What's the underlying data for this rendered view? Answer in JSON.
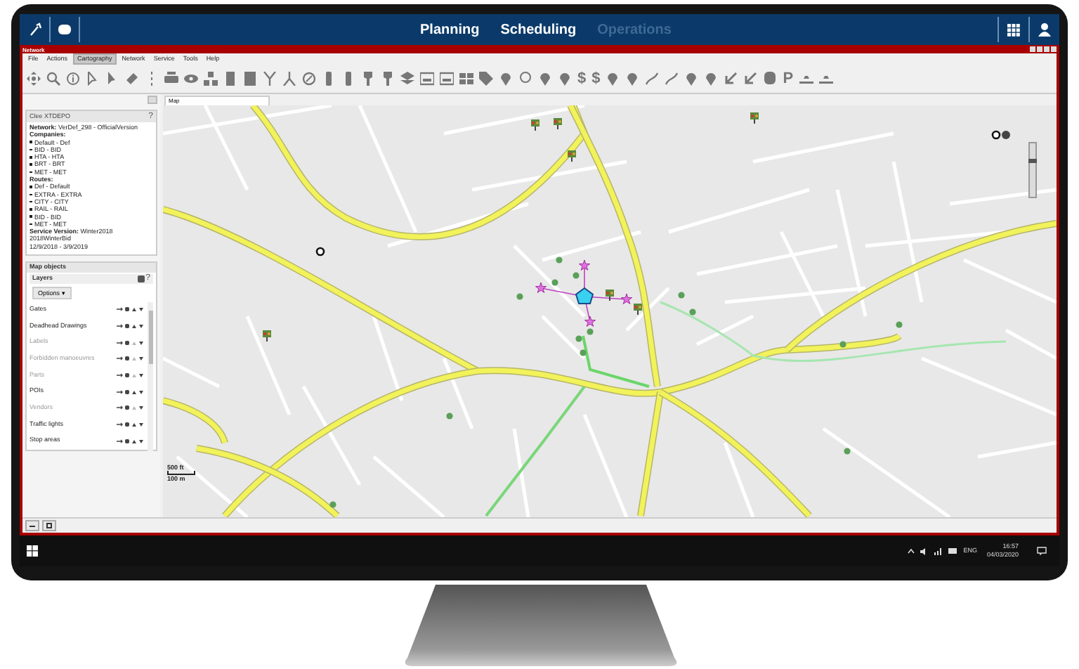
{
  "app_bar": {
    "tabs": [
      {
        "label": "Planning",
        "enabled": true
      },
      {
        "label": "Scheduling",
        "enabled": true
      },
      {
        "label": "Operations",
        "enabled": false
      }
    ]
  },
  "window": {
    "title": "Network"
  },
  "menu": [
    {
      "label": "File",
      "selected": false
    },
    {
      "label": "Actions",
      "selected": false
    },
    {
      "label": "Cartography",
      "selected": true
    },
    {
      "label": "Network",
      "selected": false
    },
    {
      "label": "Service",
      "selected": false
    },
    {
      "label": "Tools",
      "selected": false
    },
    {
      "label": "Help",
      "selected": false
    }
  ],
  "toolbar_glyphs": [
    "$",
    "$",
    "P"
  ],
  "info_panel": {
    "title": "Clee XTDEPO",
    "help": "?",
    "lines": [
      {
        "kind": "field",
        "label": "Network:",
        "value": "VerDef_298 - OfficialVersion"
      },
      {
        "kind": "heading",
        "label": "Companies:"
      },
      {
        "kind": "bullet",
        "label": "Default - Def"
      },
      {
        "kind": "bullet",
        "label": "BID - BID"
      },
      {
        "kind": "bullet",
        "label": "HTA - HTA"
      },
      {
        "kind": "bullet",
        "label": "BRT - BRT"
      },
      {
        "kind": "bullet",
        "label": "MET - MET"
      },
      {
        "kind": "heading",
        "label": "Routes:"
      },
      {
        "kind": "bullet",
        "label": "Def - Default"
      },
      {
        "kind": "bullet",
        "label": "EXTRA - EXTRA"
      },
      {
        "kind": "bullet",
        "label": "CITY - CITY"
      },
      {
        "kind": "bullet",
        "label": "RAIL - RAIL"
      },
      {
        "kind": "bullet",
        "label": "BID - BID"
      },
      {
        "kind": "bullet",
        "label": "MET - MET"
      },
      {
        "kind": "field",
        "label": "Service Version:",
        "value": "Winter2018"
      },
      {
        "kind": "plain",
        "label": "2018WinterBid"
      },
      {
        "kind": "plain",
        "label": "12/9/2018 - 3/9/2019"
      }
    ]
  },
  "map_objects": {
    "title": "Map objects",
    "layers_title": "Layers",
    "help": "?",
    "options": "Options ▾",
    "layers": [
      {
        "label": "Gates",
        "enabled": true
      },
      {
        "label": "Deadhead Drawings",
        "enabled": true
      },
      {
        "label": "Labels",
        "enabled": false
      },
      {
        "label": "Forbidden manoeuvres",
        "enabled": false
      },
      {
        "label": "Parts",
        "enabled": false
      },
      {
        "label": "POIs",
        "enabled": true
      },
      {
        "label": "Vendors",
        "enabled": false
      },
      {
        "label": "Traffic lights",
        "enabled": true
      },
      {
        "label": "Stop areas",
        "enabled": true
      }
    ]
  },
  "map": {
    "tab": "Map",
    "scale": [
      "500 ft",
      "100 m"
    ],
    "zoom": {
      "level": 0.7
    }
  },
  "taskbar": {
    "language": "ENG",
    "time": "16:57",
    "date": "04/03/2020"
  }
}
